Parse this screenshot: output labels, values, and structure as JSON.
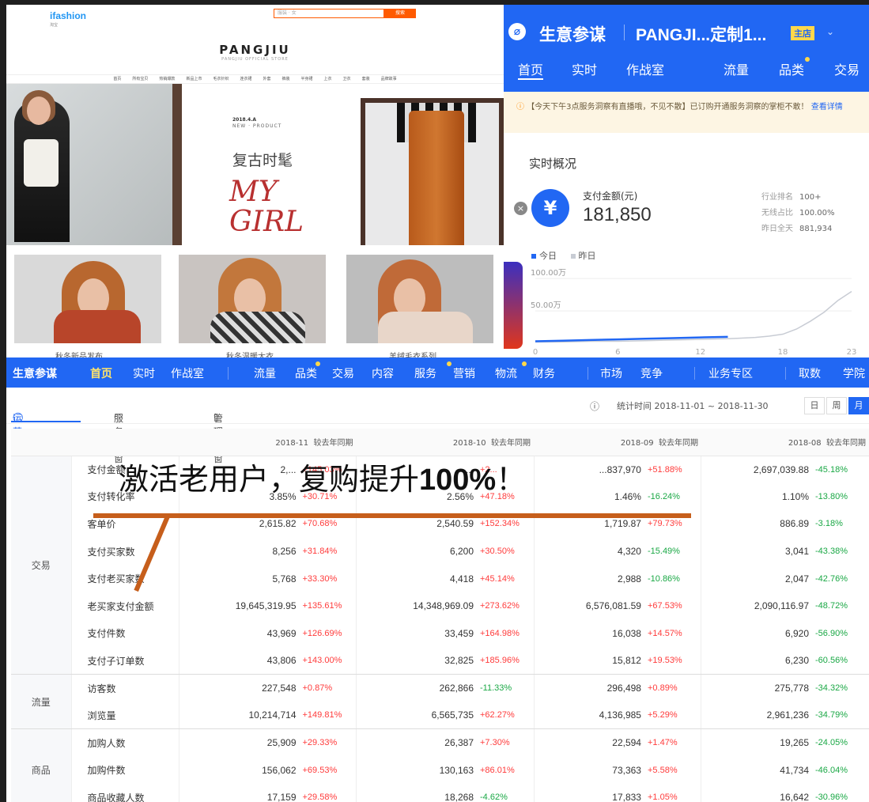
{
  "store": {
    "logo": "ifashion",
    "logo_sub": "淘宝",
    "search_placeholder": "服装 · 女",
    "search_button": "搜索",
    "brand": "PANGJIU",
    "brand_sub": "PANGJIU OFFICIAL STORE",
    "nav": [
      "首页",
      "所有宝贝",
      "热销爆款",
      "新品上市",
      "毛衣针织",
      "连衣裙",
      "外套",
      "裤装",
      "半身裙",
      "上衣",
      "卫衣",
      "套装",
      "品牌故事"
    ],
    "banner": {
      "date": "2018.4.A",
      "new": "NEW · PRODUCT",
      "title": "复古时髦",
      "script": "MY GIRL"
    },
    "captions": [
      "秋冬新品发布",
      "秋冬温暖大衣",
      "羊绒毛衣系列"
    ]
  },
  "mobile": {
    "app_title": "生意参谋",
    "shop": "PANGJI...定制1...",
    "shop_badge": "主店",
    "tabs": [
      "首页",
      "实时",
      "作战室",
      "流量",
      "品类",
      "交易"
    ],
    "notice": "【今天下午3点服务洞察有直播哦，不见不散】已订购开通服务洞察的掌柜不敢！",
    "notice_link": "查看详情",
    "realtime_title": "实时概况",
    "pay_label": "支付金额(元)",
    "pay_amount": "181,850",
    "stats": [
      {
        "label": "行业排名",
        "value": "100+"
      },
      {
        "label": "无线占比",
        "value": "100.00%"
      },
      {
        "label": "昨日全天",
        "value": "881,934"
      }
    ],
    "legend_today": "今日",
    "legend_yesterday": "昨日",
    "y_ticks": [
      "100.00万",
      "50.00万"
    ],
    "x_ticks": [
      "0",
      "6",
      "12",
      "18",
      "23"
    ],
    "colors": {
      "today": "#2167f3",
      "yesterday": "#c8ccd4"
    }
  },
  "chart_data": {
    "type": "line",
    "x": [
      0,
      2,
      4,
      6,
      8,
      10,
      12,
      14,
      15,
      16,
      17,
      18,
      19,
      20,
      21,
      22,
      23
    ],
    "series": [
      {
        "name": "今日",
        "values": [
          3,
          4,
          5,
          6,
          7,
          8,
          9,
          10
        ]
      },
      {
        "name": "昨日",
        "values": [
          2,
          2,
          3,
          3,
          4,
          5,
          6,
          7,
          8,
          9,
          11,
          14,
          22,
          34,
          48,
          66,
          80
        ]
      }
    ],
    "ylabel": "",
    "ylim": [
      0,
      110
    ],
    "y_unit": "万"
  },
  "table": {
    "nav": [
      "生意参谋",
      "首页",
      "实时",
      "作战室",
      "流量",
      "品类",
      "交易",
      "内容",
      "服务",
      "营销",
      "物流",
      "财务",
      "市场",
      "竞争",
      "业务专区",
      "取数",
      "学院"
    ],
    "subtabs": [
      "运营视窗",
      "服务视窗",
      "管理视窗"
    ],
    "stat_time": "统计时间 2018-11-01 ~ 2018-11-30",
    "periods": [
      "日",
      "周",
      "月"
    ],
    "columns": [
      "2018-11",
      "2018-10",
      "2018-09",
      "2018-08"
    ],
    "compare_label": "较去年同期",
    "groups": [
      {
        "category": "交易",
        "rows": [
          {
            "metric": "支付金额",
            "cells": [
              [
                "2,...",
                "+145.03%"
              ],
              [
                "...",
                "+2..."
              ],
              [
                "...837,970",
                "+51.88%"
              ],
              [
                "2,697,039.88",
                "-45.18%"
              ]
            ]
          },
          {
            "metric": "支付转化率",
            "cells": [
              [
                "3.85%",
                "+30.71%"
              ],
              [
                "2.56%",
                "+47.18%"
              ],
              [
                "1.46%",
                "-16.24%"
              ],
              [
                "1.10%",
                "-13.80%"
              ]
            ]
          },
          {
            "metric": "客单价",
            "cells": [
              [
                "2,615.82",
                "+70.68%"
              ],
              [
                "2,540.59",
                "+152.34%"
              ],
              [
                "1,719.87",
                "+79.73%"
              ],
              [
                "886.89",
                "-3.18%"
              ]
            ]
          },
          {
            "metric": "支付买家数",
            "cells": [
              [
                "8,256",
                "+31.84%"
              ],
              [
                "6,200",
                "+30.50%"
              ],
              [
                "4,320",
                "-15.49%"
              ],
              [
                "3,041",
                "-43.38%"
              ]
            ]
          },
          {
            "metric": "支付老买家数",
            "cells": [
              [
                "5,768",
                "+33.30%"
              ],
              [
                "4,418",
                "+45.14%"
              ],
              [
                "2,988",
                "-10.86%"
              ],
              [
                "2,047",
                "-42.76%"
              ]
            ]
          },
          {
            "metric": "老买家支付金额",
            "cells": [
              [
                "19,645,319.95",
                "+135.61%"
              ],
              [
                "14,348,969.09",
                "+273.62%"
              ],
              [
                "6,576,081.59",
                "+67.53%"
              ],
              [
                "2,090,116.97",
                "-48.72%"
              ]
            ]
          },
          {
            "metric": "支付件数",
            "cells": [
              [
                "43,969",
                "+126.69%"
              ],
              [
                "33,459",
                "+164.98%"
              ],
              [
                "16,038",
                "+14.57%"
              ],
              [
                "6,920",
                "-56.90%"
              ]
            ]
          },
          {
            "metric": "支付子订单数",
            "cells": [
              [
                "43,806",
                "+143.00%"
              ],
              [
                "32,825",
                "+185.96%"
              ],
              [
                "15,812",
                "+19.53%"
              ],
              [
                "6,230",
                "-60.56%"
              ]
            ]
          }
        ]
      },
      {
        "category": "流量",
        "rows": [
          {
            "metric": "访客数",
            "cells": [
              [
                "227,548",
                "+0.87%"
              ],
              [
                "262,866",
                "-11.33%"
              ],
              [
                "296,498",
                "+0.89%"
              ],
              [
                "275,778",
                "-34.32%"
              ]
            ]
          },
          {
            "metric": "浏览量",
            "cells": [
              [
                "10,214,714",
                "+149.81%"
              ],
              [
                "6,565,735",
                "+62.27%"
              ],
              [
                "4,136,985",
                "+5.29%"
              ],
              [
                "2,961,236",
                "-34.79%"
              ]
            ]
          }
        ]
      },
      {
        "category": "商品",
        "rows": [
          {
            "metric": "加购人数",
            "cells": [
              [
                "25,909",
                "+29.33%"
              ],
              [
                "26,387",
                "+7.30%"
              ],
              [
                "22,594",
                "+1.47%"
              ],
              [
                "19,265",
                "-24.05%"
              ]
            ]
          },
          {
            "metric": "加购件数",
            "cells": [
              [
                "156,062",
                "+69.53%"
              ],
              [
                "130,163",
                "+86.01%"
              ],
              [
                "73,363",
                "+5.58%"
              ],
              [
                "41,734",
                "-46.04%"
              ]
            ]
          },
          {
            "metric": "商品收藏人数",
            "cells": [
              [
                "17,159",
                "+29.58%"
              ],
              [
                "18,268",
                "-4.62%"
              ],
              [
                "17,833",
                "+1.05%"
              ],
              [
                "16,642",
                "-30.96%"
              ]
            ]
          }
        ]
      }
    ]
  },
  "overlay": {
    "text": "激活老用户，复购提升",
    "highlight": "100%",
    "tail": "！",
    "color": "#c65e1b"
  }
}
